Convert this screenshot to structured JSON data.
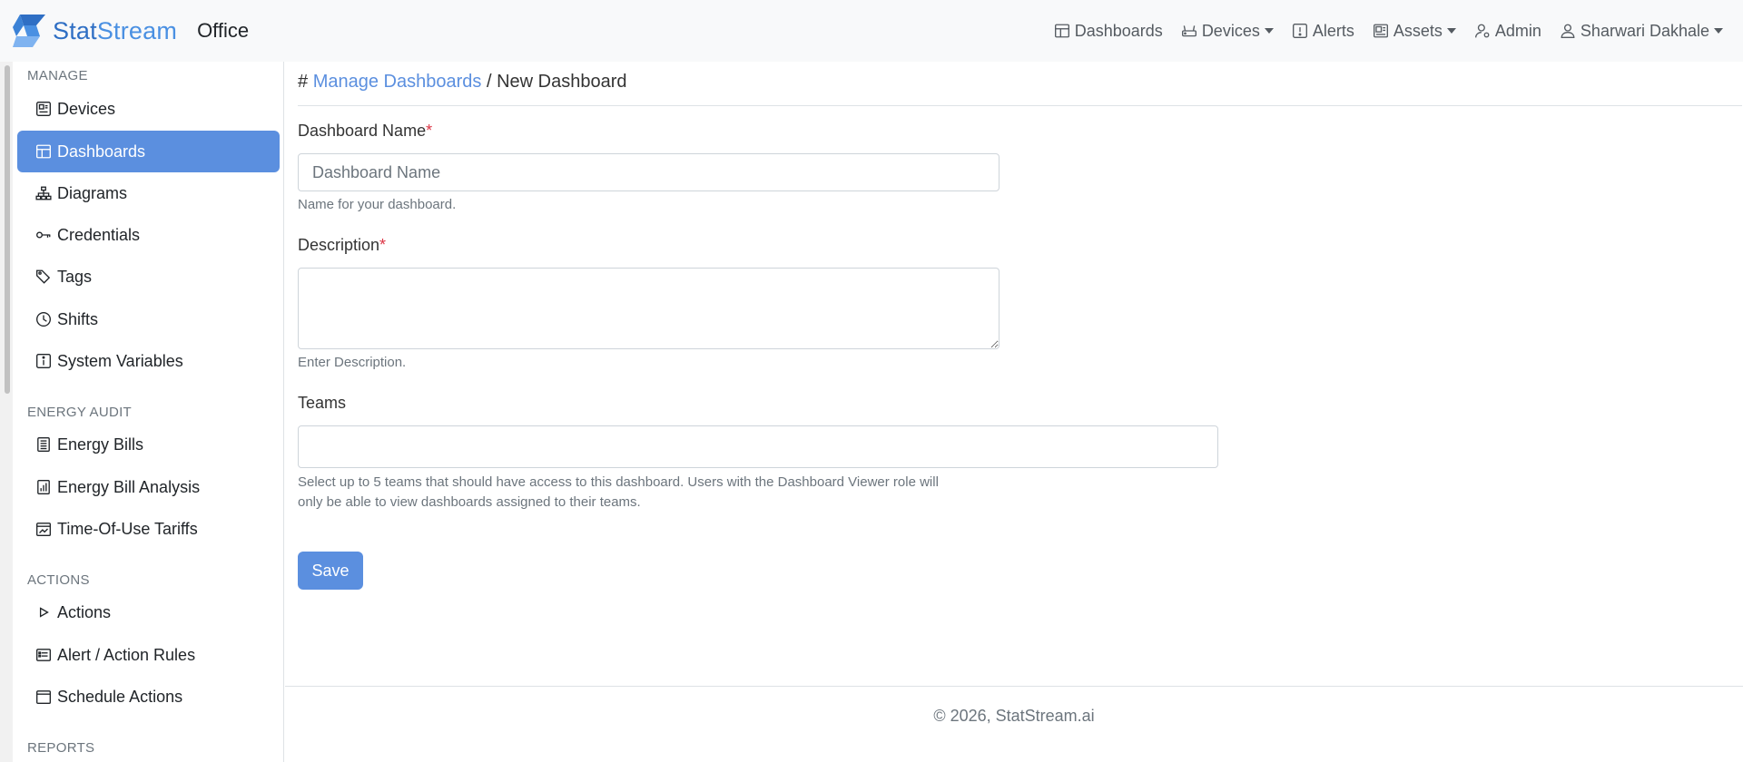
{
  "brand": {
    "name_part1": "Stat",
    "name_part2": "Stream",
    "org": "Office"
  },
  "topnav": {
    "items": [
      {
        "label": "Dashboards",
        "icon": "dashboard-icon",
        "dropdown": false
      },
      {
        "label": "Devices",
        "icon": "router-icon",
        "dropdown": true
      },
      {
        "label": "Alerts",
        "icon": "alert-icon",
        "dropdown": false
      },
      {
        "label": "Assets",
        "icon": "assets-icon",
        "dropdown": true
      },
      {
        "label": "Admin",
        "icon": "admin-icon",
        "dropdown": false
      },
      {
        "label": "Sharwari Dakhale",
        "icon": "user-icon",
        "dropdown": true
      }
    ]
  },
  "sidebar": {
    "sections": [
      {
        "title": "MANAGE",
        "items": [
          {
            "label": "Devices",
            "icon": "device-icon"
          },
          {
            "label": "Dashboards",
            "icon": "dashboard-icon",
            "active": true
          },
          {
            "label": "Diagrams",
            "icon": "diagram-icon"
          },
          {
            "label": "Credentials",
            "icon": "key-icon"
          },
          {
            "label": "Tags",
            "icon": "tags-icon"
          },
          {
            "label": "Shifts",
            "icon": "clock-icon"
          },
          {
            "label": "System Variables",
            "icon": "info-icon"
          }
        ]
      },
      {
        "title": "ENERGY AUDIT",
        "items": [
          {
            "label": "Energy Bills",
            "icon": "bill-icon"
          },
          {
            "label": "Energy Bill Analysis",
            "icon": "chart-icon"
          },
          {
            "label": "Time-Of-Use Tariffs",
            "icon": "calendar-chart-icon"
          }
        ]
      },
      {
        "title": "ACTIONS",
        "items": [
          {
            "label": "Actions",
            "icon": "play-icon"
          },
          {
            "label": "Alert / Action Rules",
            "icon": "list-icon"
          },
          {
            "label": "Schedule Actions",
            "icon": "calendar-icon"
          }
        ]
      },
      {
        "title": "REPORTS",
        "items": []
      }
    ]
  },
  "breadcrumb": {
    "hash": "#",
    "parent": "Manage Dashboards",
    "separator": "/",
    "current": "New Dashboard"
  },
  "form": {
    "name": {
      "label": "Dashboard Name",
      "required_mark": "*",
      "placeholder": "Dashboard Name",
      "value": "",
      "help": "Name for your dashboard."
    },
    "description": {
      "label": "Description",
      "required_mark": "*",
      "value": "",
      "help": "Enter Description."
    },
    "teams": {
      "label": "Teams",
      "value": "",
      "help_line1": "Select up to 5 teams that should have access to this dashboard. Users with the Dashboard Viewer role will",
      "help_line2": "only be able to view dashboards assigned to their teams."
    },
    "save_label": "Save"
  },
  "footer": {
    "text": "© 2026, StatStream.ai"
  },
  "colors": {
    "primary": "#5b8fdf",
    "required": "#dc3545",
    "navbar_bg": "#f8f9fa"
  }
}
